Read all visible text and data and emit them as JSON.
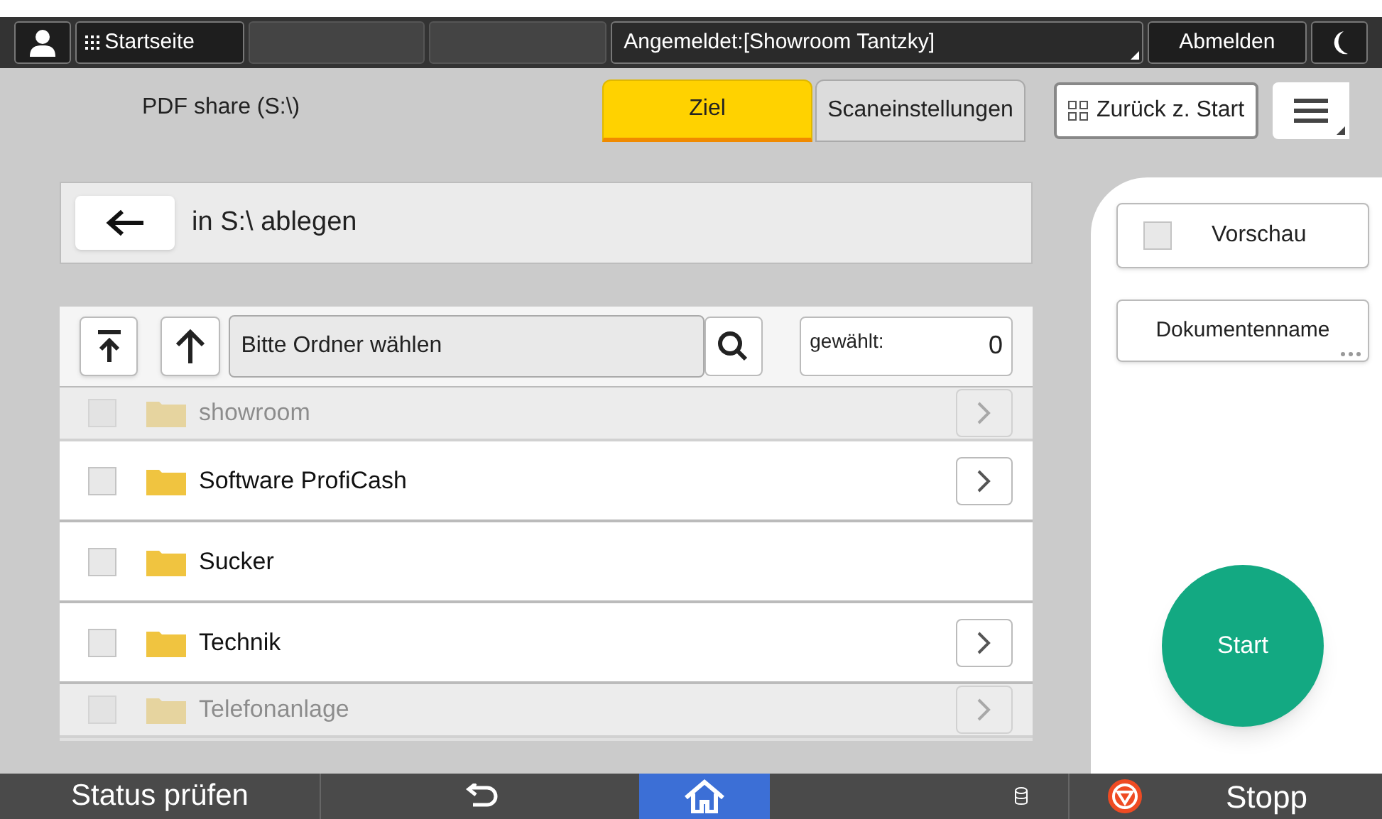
{
  "top_bar": {
    "home_label": "Startseite",
    "login": "Angemeldet:[Showroom Tantzky]",
    "logout": "Abmelden"
  },
  "header": {
    "title": "PDF share (S:\\)",
    "tabs": [
      {
        "label": "Ziel",
        "selected": true
      },
      {
        "label": "Scaneinstellungen",
        "selected": false
      }
    ],
    "back_to_start": "Zurück z. Start"
  },
  "destination": {
    "label": "in S:\\ ablegen"
  },
  "folder_browser": {
    "placeholder": "Bitte Ordner wählen",
    "selected_label": "gewählt:",
    "selected_count": "0",
    "rows": [
      {
        "name": "showroom",
        "checked": false,
        "has_subfolders": true,
        "faded": true
      },
      {
        "name": "Software ProfiCash",
        "checked": false,
        "has_subfolders": true,
        "faded": false
      },
      {
        "name": "Sucker",
        "checked": false,
        "has_subfolders": false,
        "faded": false
      },
      {
        "name": "Technik",
        "checked": false,
        "has_subfolders": true,
        "faded": false
      },
      {
        "name": "Telefonanlage",
        "checked": false,
        "has_subfolders": true,
        "faded": true
      }
    ]
  },
  "side_panel": {
    "preview": {
      "label": "Vorschau",
      "checked": false
    },
    "document_name": "Dokumentenname",
    "start": "Start"
  },
  "bottom_bar": {
    "status": "Status prüfen",
    "stop": "Stopp"
  }
}
